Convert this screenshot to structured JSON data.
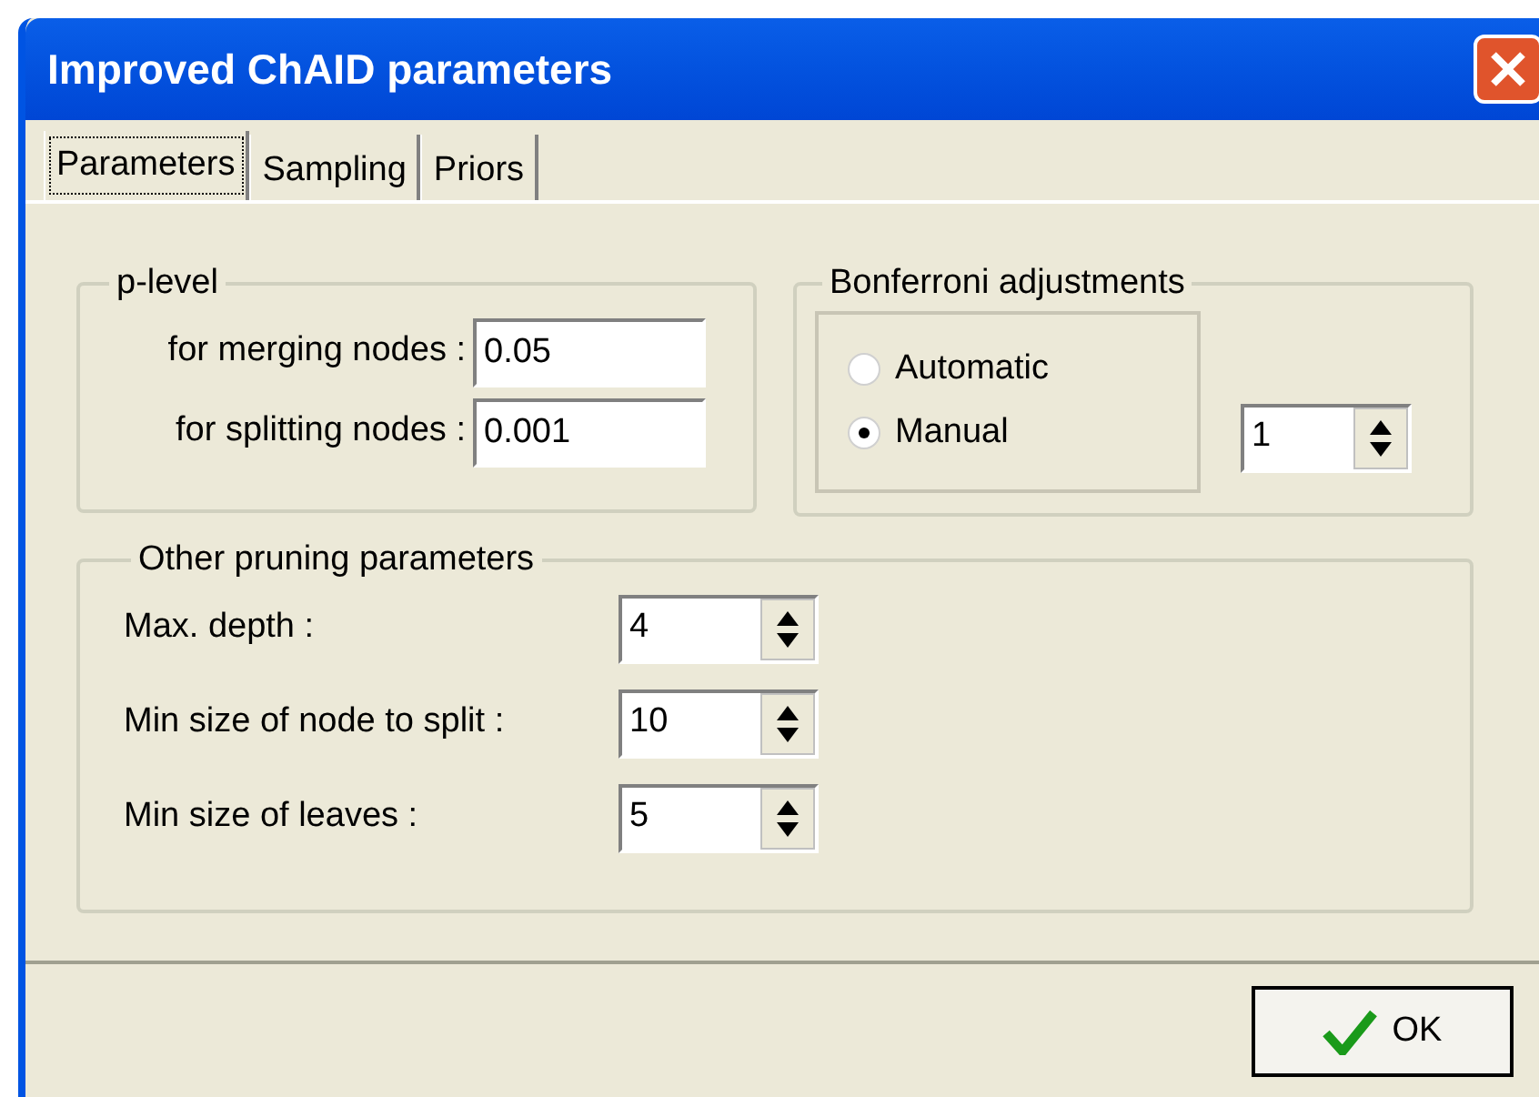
{
  "window": {
    "title": "Improved ChAID parameters"
  },
  "tabs": [
    {
      "label": "Parameters",
      "selected": true
    },
    {
      "label": "Sampling",
      "selected": false
    },
    {
      "label": "Priors",
      "selected": false
    }
  ],
  "p_level": {
    "title": "p-level",
    "fields": [
      {
        "label": "for merging nodes :",
        "value": "0.05"
      },
      {
        "label": "for splitting nodes :",
        "value": "0.001"
      }
    ]
  },
  "bonferroni": {
    "title": "Bonferroni adjustments",
    "options": [
      {
        "label": "Automatic",
        "selected": false
      },
      {
        "label": "Manual",
        "selected": true
      }
    ],
    "value": "1"
  },
  "pruning": {
    "title": "Other pruning parameters",
    "fields": [
      {
        "label": "Max. depth :",
        "value": "4"
      },
      {
        "label": "Min size of node to split :",
        "value": "10"
      },
      {
        "label": "Min size of leaves :",
        "value": "5"
      }
    ]
  },
  "buttons": [
    {
      "label": "OK"
    }
  ]
}
